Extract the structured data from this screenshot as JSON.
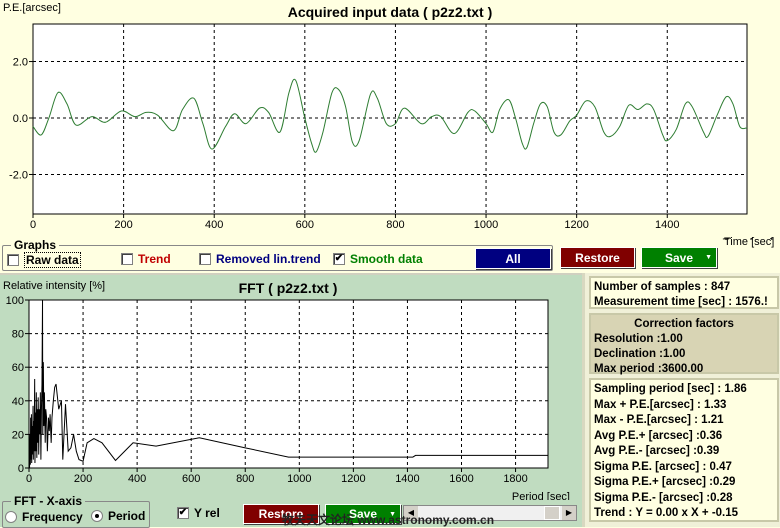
{
  "top_chart": {
    "chart_data": {
      "type": "line",
      "title": "Acquired input data ( p2z2.txt )",
      "ylabel": "P.E.[arcsec]",
      "xlabel": "Time [sec]",
      "xlim": [
        0,
        1576
      ],
      "ylim": [
        -3.4,
        3.33
      ],
      "grid": true,
      "x_ticks": [
        0,
        200,
        400,
        600,
        800,
        1000,
        1200,
        1400
      ],
      "y_ticks": [
        "2.0",
        "0.0",
        "-2.0"
      ],
      "y_tick_values": [
        2,
        0,
        -2
      ],
      "line_color": "#2E7D32",
      "points": [
        [
          0,
          -0.3
        ],
        [
          18,
          -0.6
        ],
        [
          35,
          0
        ],
        [
          55,
          0.9
        ],
        [
          75,
          0.5
        ],
        [
          95,
          -0.25
        ],
        [
          130,
          0.05
        ],
        [
          160,
          -0.15
        ],
        [
          195,
          0.25
        ],
        [
          225,
          0.05
        ],
        [
          250,
          0.2
        ],
        [
          275,
          0.1
        ],
        [
          310,
          -0.45
        ],
        [
          330,
          0.3
        ],
        [
          355,
          0.7
        ],
        [
          375,
          -0.2
        ],
        [
          395,
          -1.1
        ],
        [
          425,
          -0.3
        ],
        [
          445,
          0.15
        ],
        [
          470,
          -0.2
        ],
        [
          500,
          0.35
        ],
        [
          520,
          0.2
        ],
        [
          545,
          -0.5
        ],
        [
          565,
          0.9
        ],
        [
          580,
          1.33
        ],
        [
          600,
          0
        ],
        [
          615,
          -0.9
        ],
        [
          625,
          -1.2
        ],
        [
          640,
          -0.5
        ],
        [
          660,
          0.9
        ],
        [
          675,
          1.0
        ],
        [
          690,
          0.4
        ],
        [
          705,
          -0.85
        ],
        [
          720,
          -0.8
        ],
        [
          745,
          0.85
        ],
        [
          760,
          0.7
        ],
        [
          780,
          -0.2
        ],
        [
          800,
          -0.2
        ],
        [
          820,
          0.35
        ],
        [
          857,
          -0.2
        ],
        [
          880,
          0.05
        ],
        [
          900,
          0.05
        ],
        [
          930,
          -0.55
        ],
        [
          960,
          0.2
        ],
        [
          975,
          0.25
        ],
        [
          1000,
          -0.2
        ],
        [
          1015,
          -0.5
        ],
        [
          1030,
          0.3
        ],
        [
          1050,
          0.65
        ],
        [
          1065,
          0
        ],
        [
          1080,
          -0.9
        ],
        [
          1090,
          -1.05
        ],
        [
          1105,
          -0.2
        ],
        [
          1120,
          0.5
        ],
        [
          1135,
          0.4
        ],
        [
          1150,
          -0.5
        ],
        [
          1165,
          -0.6
        ],
        [
          1185,
          -0.1
        ],
        [
          1200,
          0.1
        ],
        [
          1220,
          0.6
        ],
        [
          1240,
          0.4
        ],
        [
          1260,
          -0.5
        ],
        [
          1275,
          -0.65
        ],
        [
          1295,
          -0.3
        ],
        [
          1315,
          0.45
        ],
        [
          1335,
          0.3
        ],
        [
          1355,
          0.5
        ],
        [
          1370,
          0.3
        ],
        [
          1390,
          -0.6
        ],
        [
          1400,
          -0.8
        ],
        [
          1420,
          -0.4
        ],
        [
          1440,
          0.5
        ],
        [
          1455,
          0.4
        ],
        [
          1480,
          -0.5
        ],
        [
          1490,
          -0.65
        ],
        [
          1510,
          0.1
        ],
        [
          1530,
          0.75
        ],
        [
          1545,
          0.5
        ],
        [
          1560,
          -0.3
        ],
        [
          1576,
          -0.35
        ]
      ]
    }
  },
  "graphs_group": {
    "title": "Graphs",
    "raw_data": {
      "label": "Raw data",
      "checked": false,
      "color": "#000000"
    },
    "trend": {
      "label": "Trend",
      "checked": false,
      "color": "#C00000"
    },
    "removed_trend": {
      "label": "Removed lin.trend",
      "checked": false,
      "color": "#000080"
    },
    "smooth": {
      "label": "Smooth data",
      "checked": true,
      "color": "#008000"
    },
    "all_label": "All",
    "restore_label": "Restore",
    "save_label": "Save"
  },
  "fft_chart": {
    "chart_data": {
      "type": "line",
      "title": "FFT ( p2z2.txt )",
      "ylabel": "Relative intensity [%]",
      "xlabel": "Period [sec]",
      "xlim": [
        0,
        1920
      ],
      "ylim": [
        0,
        100
      ],
      "grid": true,
      "x_ticks": [
        0,
        200,
        400,
        600,
        800,
        1000,
        1200,
        1400,
        1600,
        1800
      ],
      "y_ticks": [
        0,
        20,
        40,
        60,
        80,
        100
      ],
      "line_color": "#000000",
      "points": [
        [
          2,
          0
        ],
        [
          4,
          20
        ],
        [
          5,
          2
        ],
        [
          6,
          30
        ],
        [
          8,
          5
        ],
        [
          9,
          32
        ],
        [
          10,
          3
        ],
        [
          12,
          25
        ],
        [
          13,
          8
        ],
        [
          15,
          37
        ],
        [
          16,
          5
        ],
        [
          18,
          28
        ],
        [
          19,
          10
        ],
        [
          21,
          53
        ],
        [
          22,
          3
        ],
        [
          24,
          33
        ],
        [
          26,
          10
        ],
        [
          27,
          45
        ],
        [
          29,
          6
        ],
        [
          30,
          35
        ],
        [
          32,
          15
        ],
        [
          34,
          42
        ],
        [
          36,
          8
        ],
        [
          38,
          35
        ],
        [
          40,
          20
        ],
        [
          42,
          45
        ],
        [
          44,
          5
        ],
        [
          46,
          35
        ],
        [
          48,
          50
        ],
        [
          50,
          100
        ],
        [
          51,
          20
        ],
        [
          53,
          63
        ],
        [
          55,
          25
        ],
        [
          57,
          45
        ],
        [
          60,
          15
        ],
        [
          62,
          35
        ],
        [
          65,
          30
        ],
        [
          68,
          10
        ],
        [
          72,
          30
        ],
        [
          75,
          22
        ],
        [
          78,
          32
        ],
        [
          82,
          15
        ],
        [
          85,
          30
        ],
        [
          90,
          40
        ],
        [
          95,
          48
        ],
        [
          100,
          50
        ],
        [
          110,
          35
        ],
        [
          120,
          40
        ],
        [
          125,
          5
        ],
        [
          135,
          38
        ],
        [
          145,
          10
        ],
        [
          155,
          12
        ],
        [
          165,
          20
        ],
        [
          175,
          10
        ],
        [
          185,
          5
        ],
        [
          200,
          4
        ],
        [
          215,
          15
        ],
        [
          240,
          17.5
        ],
        [
          270,
          15
        ],
        [
          320,
          4.5
        ],
        [
          385,
          15
        ],
        [
          470,
          13
        ],
        [
          630,
          18
        ],
        [
          800,
          12
        ],
        [
          960,
          6.5
        ],
        [
          1420,
          6.5
        ],
        [
          1430,
          7.5
        ],
        [
          1920,
          7.5
        ]
      ]
    }
  },
  "fft_controls": {
    "axis_group_title": "FFT - X-axis",
    "frequency_label": "Frequency",
    "period_label": "Period",
    "selected": "Period",
    "yrel_label": "Y rel",
    "yrel_checked": true,
    "restore_label": "Restore",
    "save_label": "Save",
    "watermark": "牧夫天文论坛 www.astronomy.com.cn"
  },
  "info": {
    "samples": "Number of samples : 847",
    "measurement_time": "Measurement time [sec] : 1576.!",
    "correction_title": "Correction factors",
    "resolution": "Resolution :1.00",
    "declination": "Declination :1.00",
    "max_period": "Max period :3600.00",
    "stats": [
      "Sampling period [sec] : 1.86",
      "Max + P.E.[arcsec] : 1.33",
      "Max - P.E.[arcsec] : 1.21",
      "Avg P.E.+ [arcsec] :0.36",
      "Avg P.E.- [arcsec] :0.39",
      "Sigma P.E. [arcsec] : 0.47",
      "Sigma P.E.+ [arcsec] :0.29",
      "Sigma P.E.- [arcsec] :0.28",
      "Trend : Y = 0.00 x X + -0.15"
    ]
  },
  "colors": {
    "all_button": "#000080",
    "restore_button": "#800000",
    "save_button": "#008000",
    "fft_panel": "#C0DCC0",
    "top_panel": "#FFFFE1"
  }
}
